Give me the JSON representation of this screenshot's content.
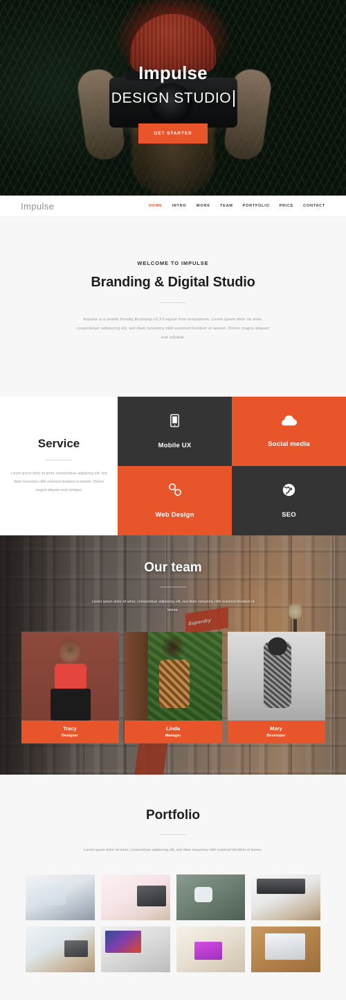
{
  "hero": {
    "title": "Impulse",
    "subtitle": "DESIGN STUDIO",
    "cta_label": "GET STARTED"
  },
  "navbar": {
    "brand": "Impulse",
    "links": [
      {
        "label": "HOME",
        "active": true
      },
      {
        "label": "INTRO",
        "active": false
      },
      {
        "label": "WORK",
        "active": false
      },
      {
        "label": "TEAM",
        "active": false
      },
      {
        "label": "PORTFOLIO",
        "active": false
      },
      {
        "label": "PRICE",
        "active": false
      },
      {
        "label": "CONTACT",
        "active": false
      }
    ]
  },
  "intro": {
    "eyebrow": "WELCOME TO IMPULSE",
    "title": "Branding & Digital Studio",
    "paragraph": "Impulse is a mobile friendly Bootstrap v3.3.5 layout from templatemo. Lorem ipsum dolor sit amet, consectetuer adipiscing elit, sed diam nonummy nibh euismod tincidunt ut laoreet. Dolore magna aliquam erat volutpat."
  },
  "service": {
    "title": "Service",
    "paragraph": "Lorem ipsum dolor sit amet, consectetuer adipiscing elit, sed diam nonummy nibh euismod tincidunt ut laoreet. Dolore magna aliquam erat volutpat.",
    "tiles": [
      {
        "label": "Mobile UX",
        "icon": "mobile-phone-icon",
        "theme": "dark"
      },
      {
        "label": "Social media",
        "icon": "cloud-icon",
        "theme": "orange"
      },
      {
        "label": "Web Design",
        "icon": "chain-link-icon",
        "theme": "orange"
      },
      {
        "label": "SEO",
        "icon": "globe-icon",
        "theme": "dark"
      }
    ]
  },
  "team": {
    "title": "Our team",
    "paragraph": "Lorem ipsum dolor sit amet, consectetuer adipiscing elit, sed diam nonummy nibh euismod tincidunt ut laoree.",
    "background_sign": "Superdry",
    "members": [
      {
        "name": "Tracy",
        "role": "Designer"
      },
      {
        "name": "Linda",
        "role": "Manager"
      },
      {
        "name": "Mary",
        "role": "Developer"
      }
    ]
  },
  "portfolio": {
    "title": "Portfolio",
    "paragraph": "Lorem ipsum dolor sit amet, consectetuer adipiscing elit, sed diam nonummy nibh euismod tincidunt ut laoree.",
    "items": [
      {
        "alt": "laptop-with-chart-on-screen"
      },
      {
        "alt": "laptop-on-desk-with-notes"
      },
      {
        "alt": "hand-wearing-smartwatch"
      },
      {
        "alt": "imac-keyboard-and-mouse"
      },
      {
        "alt": "person-typing-on-laptop"
      },
      {
        "alt": "imac-with-colorful-wallpaper"
      },
      {
        "alt": "laptop-with-purple-screen"
      },
      {
        "alt": "macbook-notebook-and-coffee"
      }
    ]
  },
  "colors": {
    "accent": "#e9552a",
    "dark_tile": "#343434",
    "section_bg": "#f7f7f7",
    "body_text": "#9a9a9a",
    "heading": "#1e1e1e"
  }
}
